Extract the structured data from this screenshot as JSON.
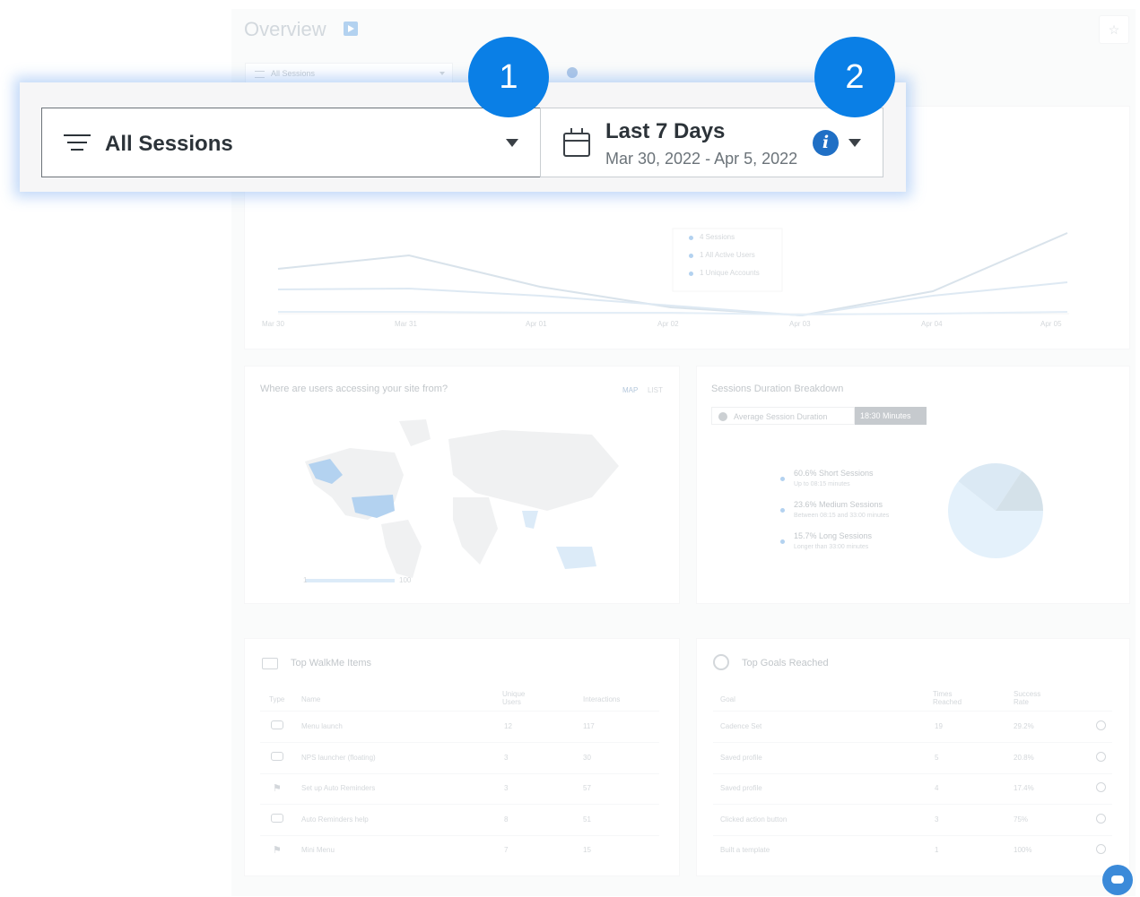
{
  "overview": {
    "title": "Overview",
    "filter_label": "All Sessions"
  },
  "line_chart": {
    "x_labels": [
      "Mar 30",
      "Mar 31",
      "Apr 01",
      "Apr 02",
      "Apr 03",
      "Apr 04",
      "Apr 05"
    ],
    "legend": [
      "4 Sessions",
      "1 All Active Users",
      "1 Unique Accounts"
    ]
  },
  "map_card": {
    "title": "Where are users accessing your site from?",
    "tab_map": "MAP",
    "tab_list": "LIST",
    "scale_min": "1",
    "scale_max": "100"
  },
  "duration_card": {
    "title": "Sessions Duration Breakdown",
    "avg_label": "Average Session Duration",
    "avg_value": "18:30 Minutes",
    "items": [
      {
        "label": "60.6% Short Sessions",
        "sub": "Up to 08:15 minutes"
      },
      {
        "label": "23.6% Medium Sessions",
        "sub": "Between 08:15 and 33:00 minutes"
      },
      {
        "label": "15.7% Long Sessions",
        "sub": "Longer than 33:00 minutes"
      }
    ],
    "colors": [
      "#b9dcf6",
      "#a3c8e4",
      "#8fb1c8"
    ]
  },
  "walkme_card": {
    "title": "Top WalkMe Items",
    "headers": [
      "Type",
      "Name",
      "Unique Users",
      "Interactions"
    ],
    "rows": [
      {
        "name": "Menu launch",
        "users": "12",
        "interactions": "117"
      },
      {
        "name": "NPS launcher (floating)",
        "users": "3",
        "interactions": "30"
      },
      {
        "name": "Set up Auto Reminders",
        "users": "3",
        "interactions": "57"
      },
      {
        "name": "Auto Reminders help",
        "users": "8",
        "interactions": "51"
      },
      {
        "name": "Mini Menu",
        "users": "7",
        "interactions": "15"
      }
    ]
  },
  "goals_card": {
    "title": "Top Goals Reached",
    "headers": [
      "Goal",
      "Times Reached",
      "Success Rate"
    ],
    "rows": [
      {
        "goal": "Cadence Set",
        "times": "19",
        "rate": "29.2%"
      },
      {
        "goal": "Saved profile",
        "times": "5",
        "rate": "20.8%"
      },
      {
        "goal": "Saved profile",
        "times": "4",
        "rate": "17.4%"
      },
      {
        "goal": "Clicked action button",
        "times": "3",
        "rate": "75%"
      },
      {
        "goal": "Built a template",
        "times": "1",
        "rate": "100%"
      }
    ]
  },
  "callout": {
    "filter_label": "All Sessions",
    "date_title": "Last 7 Days",
    "date_range": "Mar 30, 2022 - Apr 5, 2022",
    "info_glyph": "i",
    "step1": "1",
    "step2": "2"
  },
  "colors": {
    "accent": "#0a7fe6",
    "info": "#1f6fc5"
  }
}
